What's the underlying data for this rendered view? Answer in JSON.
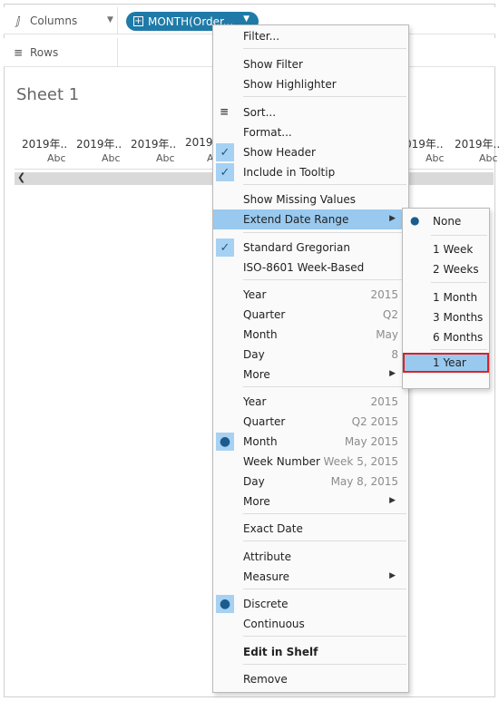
{
  "shelves": {
    "columns_label": "Columns",
    "rows_label": "Rows",
    "columns_icon": "columns-icon",
    "rows_icon": "rows-icon",
    "pill_label": "MONTH(Order..."
  },
  "sheet": {
    "title": "Sheet 1",
    "column_headers": [
      "2019年..",
      "2019年..",
      "2019年..",
      "2019",
      "019年..",
      "2019年.."
    ],
    "column_subs": [
      "Abc",
      "Abc",
      "Abc",
      "A",
      "Abc",
      "Abc"
    ]
  },
  "menu": {
    "filter": "Filter...",
    "show_filter": "Show Filter",
    "show_highlighter": "Show Highlighter",
    "sort": "Sort...",
    "format": "Format...",
    "show_header": "Show Header",
    "include_tooltip": "Include in Tooltip",
    "show_missing": "Show Missing Values",
    "extend_date_range": "Extend Date Range",
    "standard_gregorian": "Standard Gregorian",
    "iso_week": "ISO-8601 Week-Based",
    "discrete_parts": [
      {
        "label": "Year",
        "value": "2015"
      },
      {
        "label": "Quarter",
        "value": "Q2"
      },
      {
        "label": "Month",
        "value": "May"
      },
      {
        "label": "Day",
        "value": "8"
      },
      {
        "label": "More",
        "value": ""
      }
    ],
    "exact_parts": [
      {
        "label": "Year",
        "value": "2015"
      },
      {
        "label": "Quarter",
        "value": "Q2 2015"
      },
      {
        "label": "Month",
        "value": "May 2015"
      },
      {
        "label": "Week Number",
        "value": "Week 5, 2015"
      },
      {
        "label": "Day",
        "value": "May 8, 2015"
      },
      {
        "label": "More",
        "value": ""
      }
    ],
    "exact_date": "Exact Date",
    "attribute": "Attribute",
    "measure": "Measure",
    "discrete": "Discrete",
    "continuous": "Continuous",
    "edit_in_shelf": "Edit in Shelf",
    "remove": "Remove"
  },
  "submenu": {
    "none": "None",
    "week1": "1 Week",
    "week2": "2 Weeks",
    "month1": "1 Month",
    "month3": "3 Months",
    "month6": "6 Months",
    "year1": "1 Year"
  },
  "colors": {
    "pill": "#1f7aa8",
    "highlight": "#99c9ef",
    "check_bg": "#a7d1f2",
    "selection_outline": "#d8232a"
  }
}
